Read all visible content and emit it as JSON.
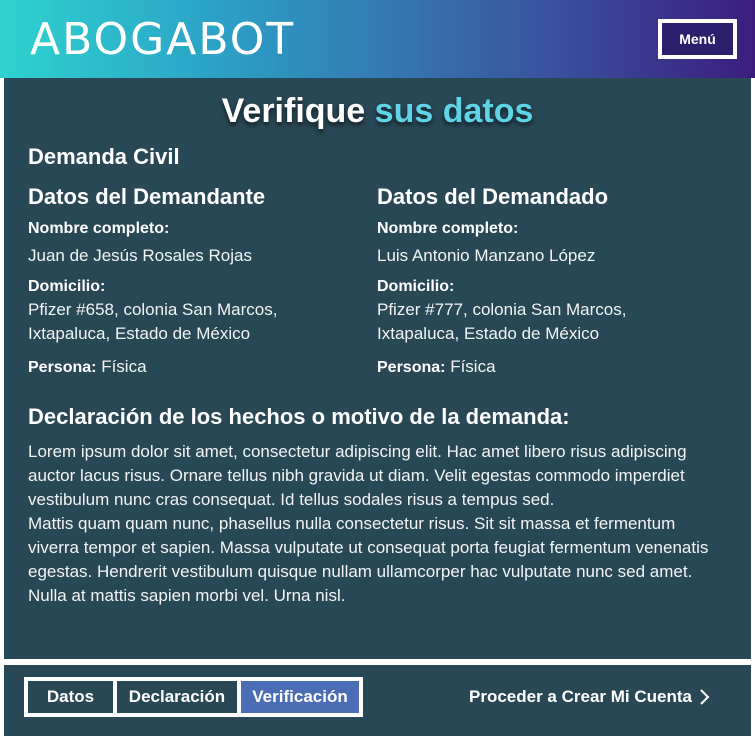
{
  "header": {
    "logo": "ABOGABOT",
    "menu_label": "Menú"
  },
  "page": {
    "title_main": "Verifique",
    "title_accent": "sus datos",
    "document_type": "Demanda Civil"
  },
  "plaintiff": {
    "heading": "Datos del Demandante",
    "name_label": "Nombre completo:",
    "name": "Juan de Jesús Rosales Rojas",
    "address_label": "Domicilio:",
    "address_line1": "Pfizer #658, colonia San Marcos,",
    "address_line2": "Ixtapaluca, Estado de México",
    "person_label": "Persona:",
    "person_type": "Física"
  },
  "defendant": {
    "heading": "Datos del Demandado",
    "name_label": "Nombre completo:",
    "name": "Luis Antonio Manzano López",
    "address_label": "Domicilio:",
    "address_line1": "Pfizer #777, colonia San Marcos,",
    "address_line2": "Ixtapaluca, Estado de México",
    "person_label": "Persona:",
    "person_type": "Física"
  },
  "declaration": {
    "heading": "Declaración de los hechos o motivo de la demanda:",
    "paragraph1": "Lorem ipsum dolor sit amet, consectetur adipiscing elit. Hac amet libero risus adipiscing auctor lacus risus. Ornare tellus nibh gravida ut diam. Velit egestas commodo imperdiet vestibulum nunc cras consequat. Id tellus sodales risus a tempus sed.",
    "paragraph2": "Mattis quam quam nunc, phasellus nulla consectetur risus. Sit sit massa et fermentum viverra tempor et sapien. Massa vulputate ut consequat porta feugiat fermentum venenatis egestas. Hendrerit vestibulum quisque nullam ullamcorper hac vulputate nunc sed amet. Nulla at mattis sapien morbi vel. Urna nisl."
  },
  "footer": {
    "steps": [
      "Datos",
      "Declaración",
      "Verificación"
    ],
    "active_step": "Verificación",
    "proceed_label": "Proceder a Crear Mi Cuenta",
    "proceed_icon": "chevron-right-icon"
  },
  "colors": {
    "panel": "#294855",
    "accent_text": "#5fd4e6",
    "active_step": "#4a6db5"
  }
}
